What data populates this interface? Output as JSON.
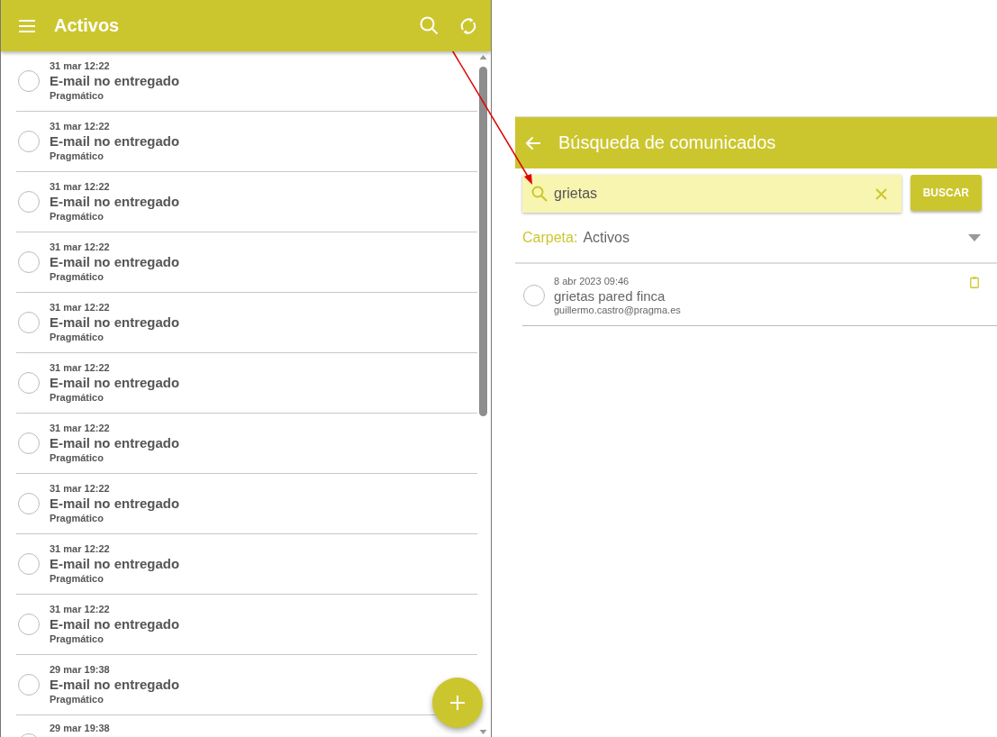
{
  "inbox": {
    "title": "Activos",
    "messages": [
      {
        "date": "31 mar 12:22",
        "subject": "E-mail no entregado",
        "sender": "Pragmático"
      },
      {
        "date": "31 mar 12:22",
        "subject": "E-mail no entregado",
        "sender": "Pragmático"
      },
      {
        "date": "31 mar 12:22",
        "subject": "E-mail no entregado",
        "sender": "Pragmático"
      },
      {
        "date": "31 mar 12:22",
        "subject": "E-mail no entregado",
        "sender": "Pragmático"
      },
      {
        "date": "31 mar 12:22",
        "subject": "E-mail no entregado",
        "sender": "Pragmático"
      },
      {
        "date": "31 mar 12:22",
        "subject": "E-mail no entregado",
        "sender": "Pragmático"
      },
      {
        "date": "31 mar 12:22",
        "subject": "E-mail no entregado",
        "sender": "Pragmático"
      },
      {
        "date": "31 mar 12:22",
        "subject": "E-mail no entregado",
        "sender": "Pragmático"
      },
      {
        "date": "31 mar 12:22",
        "subject": "E-mail no entregado",
        "sender": "Pragmático"
      },
      {
        "date": "31 mar 12:22",
        "subject": "E-mail no entregado",
        "sender": "Pragmático"
      },
      {
        "date": "29 mar 19:38",
        "subject": "E-mail no entregado",
        "sender": "Pragmático"
      },
      {
        "date": "29 mar 19:38"
      }
    ]
  },
  "search": {
    "title": "Búsqueda de comunicados",
    "query": "grietas",
    "button": "BUSCAR",
    "folder_label": "Carpeta:",
    "folder": "Activos",
    "results": [
      {
        "date": "8 abr 2023 09:46",
        "subject": "grietas pared finca",
        "sender": "guillermo.castro@pragma.es"
      }
    ]
  }
}
